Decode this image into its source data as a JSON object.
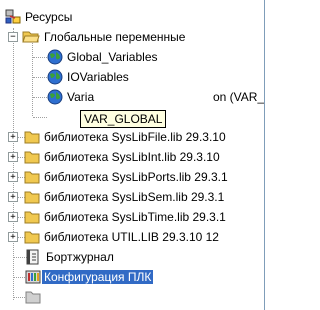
{
  "tree": {
    "root": {
      "label": "Ресурсы"
    },
    "globals": {
      "label": "Глобальные переменные",
      "children": [
        "Global_Variables",
        "IOVariables",
        "Varia"
      ],
      "third_suffix": "on (VAR_"
    },
    "libraries": [
      "библиотека SysLibFile.lib 29.3.10",
      "библиотека SysLibInt.lib 29.3.10",
      "библиотека SysLibPorts.lib 29.3.1",
      "библиотека SysLibSem.lib 29.3.1",
      "библиотека SysLibTime.lib 29.3.1",
      "библиотека UTIL.LIB 29.3.10 12"
    ],
    "journal": "Бортжурнал",
    "config": "Конфигурация ПЛК",
    "tooltip": "VAR_GLOBAL"
  },
  "colors": {
    "selection": "#316ac5",
    "tooltip_bg": "#ffffe1",
    "folder": "#f0c850"
  },
  "icons": [
    "resources-icon",
    "folder-icon",
    "globe-icon",
    "journal-icon",
    "plc-config-icon"
  ]
}
